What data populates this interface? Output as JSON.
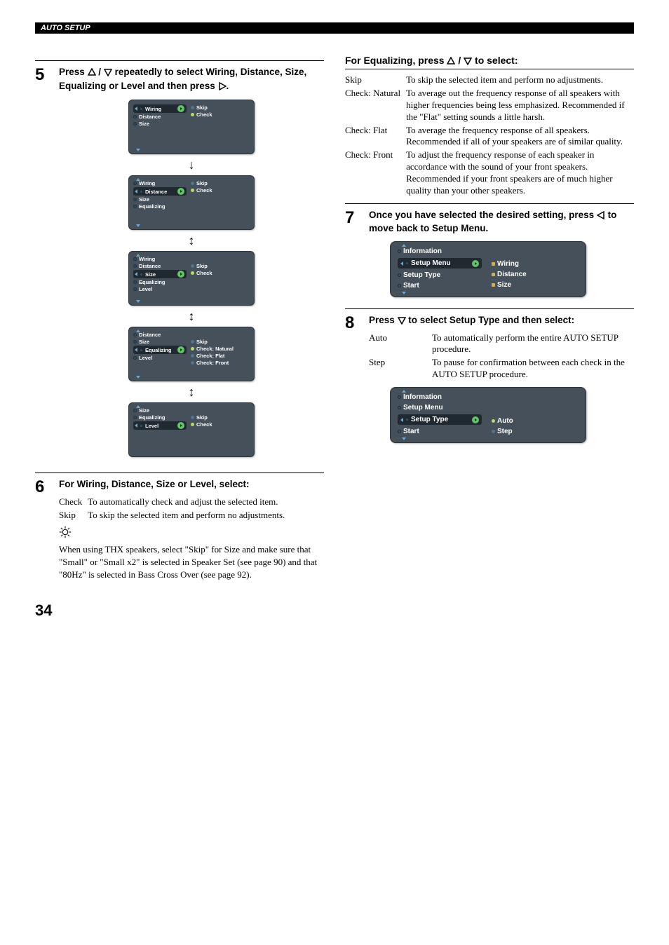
{
  "header": "AUTO SETUP",
  "page_number": "34",
  "step5": {
    "num": "5",
    "title_p1": "Press ",
    "title_p2": " / ",
    "title_p3": " repeatedly to select Wiring, Distance, Size, Equalizing or Level and then press ",
    "title_p4": "."
  },
  "screens5": {
    "s1_left": [
      "Wiring",
      "Distance",
      "Size"
    ],
    "s1_right": [
      "Skip",
      "Check"
    ],
    "s2_left": [
      "Wiring",
      "Distance",
      "Size",
      "Equalizing"
    ],
    "s2_right": [
      "Skip",
      "Check"
    ],
    "s3_left": [
      "Wiring",
      "Distance",
      "Size",
      "Equalizing",
      "Level"
    ],
    "s3_right": [
      "Skip",
      "Check"
    ],
    "s4_left": [
      "Distance",
      "Size",
      "Equalizing",
      "Level"
    ],
    "s4_right": [
      "Skip",
      "Check: Natural",
      "Check: Flat",
      "Check: Front"
    ],
    "s5_left": [
      "Size",
      "Equalizing",
      "Level"
    ],
    "s5_right": [
      "Skip",
      "Check"
    ]
  },
  "step6": {
    "num": "6",
    "title": "For Wiring, Distance, Size or Level, select:",
    "rows": {
      "check_k": "Check",
      "check_v": "To automatically check and adjust the selected item.",
      "skip_k": "Skip",
      "skip_v": "To skip the selected item and perform no adjustments."
    },
    "note": "When using THX speakers, select \"Skip\" for Size and make sure that \"Small\" or \"Small x2\" is selected in Speaker Set (see page 90) and that \"80Hz\" is selected in Bass Cross Over (see page 92)."
  },
  "eq": {
    "title_p1": "For Equalizing, press ",
    "title_p2": " / ",
    "title_p3": " to select:",
    "rows": {
      "skip_k": "Skip",
      "skip_v": "To skip the selected item and perform no adjustments.",
      "nat_k": "Check: Natural",
      "nat_v": "To average out the frequency response of all speakers with higher frequencies being less emphasized. Recommended if the \"Flat\" setting sounds a little harsh.",
      "flat_k": "Check: Flat",
      "flat_v": "To average the frequency response of all speakers. Recommended if all of your speakers are of similar quality.",
      "front_k": "Check: Front",
      "front_v": "To adjust the frequency response of each speaker in accordance with the sound of your front speakers. Recommended if your front speakers are of much higher quality than your other speakers."
    }
  },
  "step7": {
    "num": "7",
    "title_p1": "Once you have selected the desired setting, press ",
    "title_p2": " to move back to Setup Menu.",
    "screen_left": [
      "Information",
      "Setup Menu",
      "Setup Type",
      "Start"
    ],
    "screen_right": [
      "Wiring",
      "Distance",
      "Size"
    ]
  },
  "step8": {
    "num": "8",
    "title_p1": "Press ",
    "title_p2": " to select Setup Type and then select:",
    "rows": {
      "auto_k": "Auto",
      "auto_v": "To automatically perform the entire AUTO SETUP procedure.",
      "step_k": "Step",
      "step_v": "To pause for confirmation between each check in the AUTO SETUP procedure."
    },
    "screen_left": [
      "Information",
      "Setup Menu",
      "Setup Type",
      "Start"
    ],
    "screen_right": [
      "Auto",
      "Step"
    ]
  }
}
